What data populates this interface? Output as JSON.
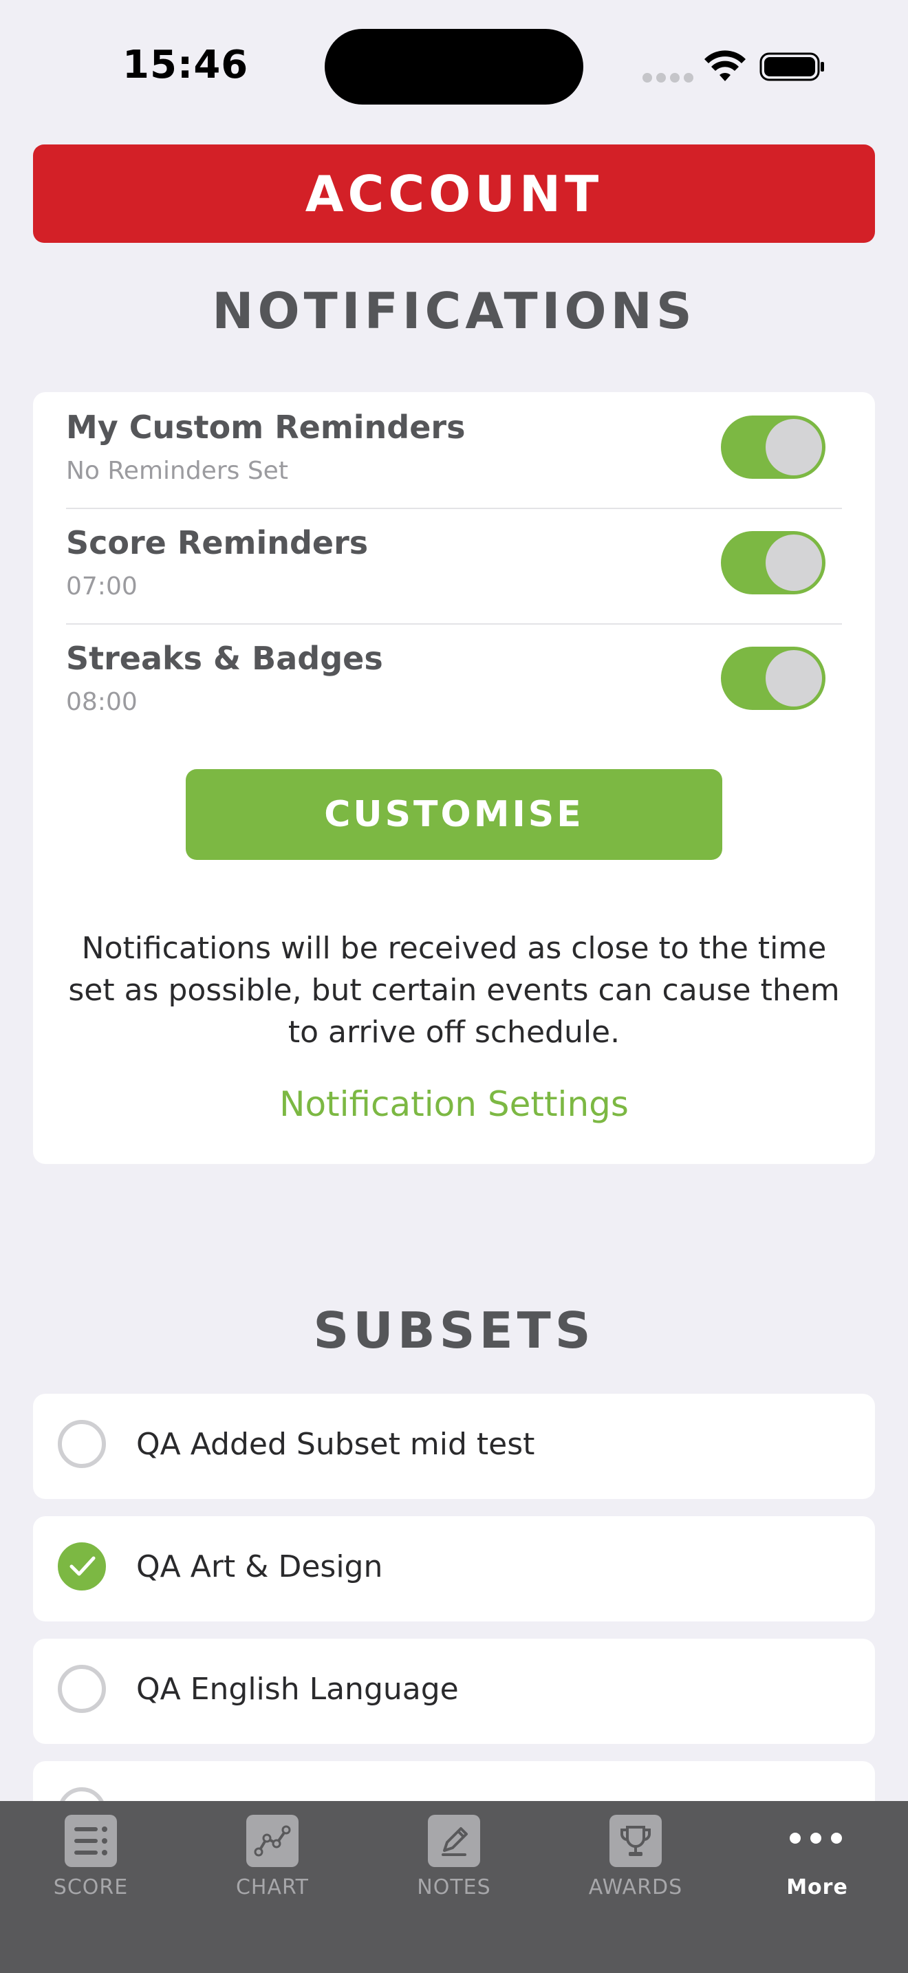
{
  "status_bar": {
    "time": "15:46",
    "icons": [
      "signal-dots-icon",
      "wifi-icon",
      "battery-icon"
    ]
  },
  "header": {
    "title": "ACCOUNT"
  },
  "notifications": {
    "title": "NOTIFICATIONS",
    "rows": [
      {
        "label": "My Custom Reminders",
        "sub": "No Reminders Set",
        "enabled": true
      },
      {
        "label": "Score Reminders",
        "sub": "07:00",
        "enabled": true
      },
      {
        "label": "Streaks & Badges",
        "sub": "08:00",
        "enabled": true
      }
    ],
    "customise_label": "CUSTOMISE",
    "info": "Notifications will be received as close to the time set as possible, but certain events can cause them to arrive off schedule.",
    "settings_link": "Notification Settings"
  },
  "subsets": {
    "title": "SUBSETS",
    "items": [
      {
        "label": "QA Added Subset mid test",
        "selected": false
      },
      {
        "label": "QA Art & Design",
        "selected": true
      },
      {
        "label": "QA English Language",
        "selected": false
      }
    ]
  },
  "tab_bar": {
    "tabs": [
      {
        "label": "SCORE",
        "icon": "score-list-icon",
        "active": false
      },
      {
        "label": "CHART",
        "icon": "chart-icon",
        "active": false
      },
      {
        "label": "NOTES",
        "icon": "notes-pencil-icon",
        "active": false
      },
      {
        "label": "AWARDS",
        "icon": "trophy-icon",
        "active": false
      },
      {
        "label": "More",
        "icon": "more-dots-icon",
        "active": true
      }
    ]
  },
  "colors": {
    "header_red": "#d32027",
    "accent_green": "#7cb843",
    "background": "#f0eff5",
    "tab_bar": "#59595b"
  }
}
